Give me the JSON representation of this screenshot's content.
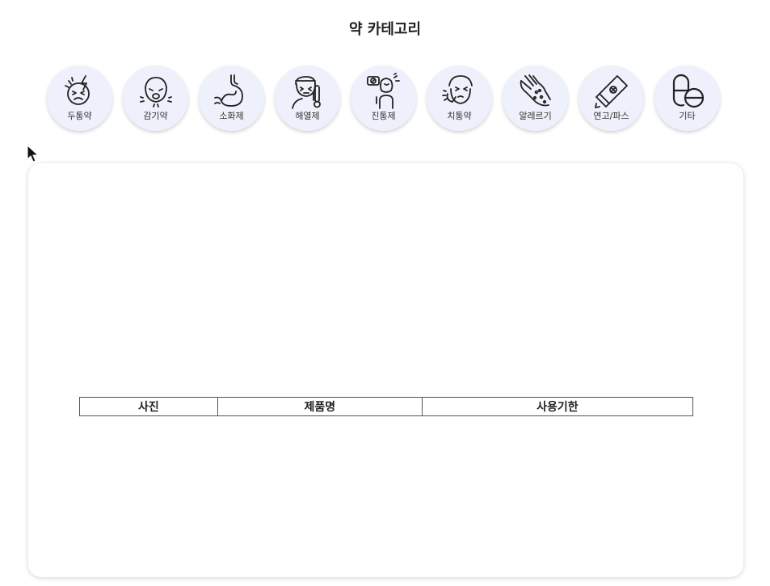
{
  "page_title": "약 카테고리",
  "categories": [
    {
      "label": "두통약",
      "icon": "headache-icon"
    },
    {
      "label": "감기약",
      "icon": "cold-sneeze-icon"
    },
    {
      "label": "소화제",
      "icon": "stomach-icon"
    },
    {
      "label": "해열제",
      "icon": "fever-thermometer-icon"
    },
    {
      "label": "진통제",
      "icon": "pain-relief-icon"
    },
    {
      "label": "치통약",
      "icon": "toothache-icon"
    },
    {
      "label": "알레르기",
      "icon": "allergy-hand-icon"
    },
    {
      "label": "연고/파스",
      "icon": "ointment-tube-icon"
    },
    {
      "label": "기타",
      "icon": "capsule-pill-icon"
    }
  ],
  "table": {
    "headers": [
      "사진",
      "제품명",
      "사용기한"
    ]
  },
  "colors": {
    "category_bg": "#eef1fb",
    "icon_stroke": "#222222"
  }
}
